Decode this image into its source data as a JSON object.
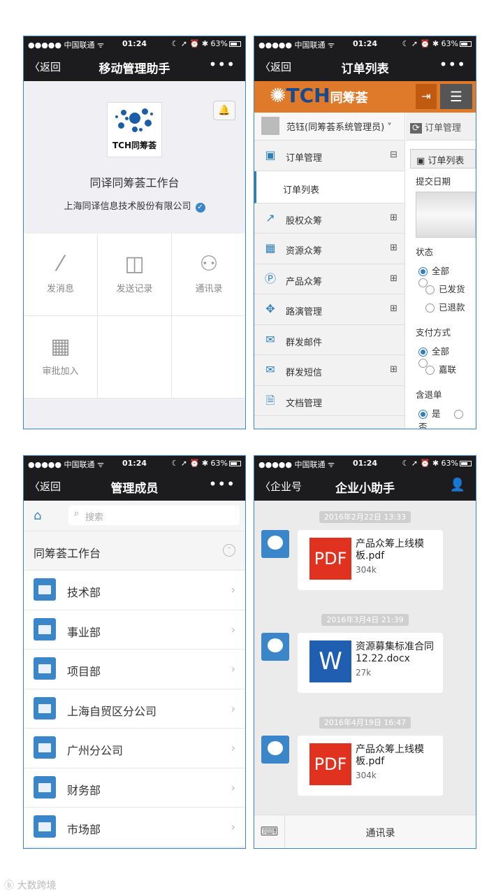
{
  "status": {
    "carrier": "●●●●● 中国联通 ᯤ",
    "time": "01:24",
    "battery": "63%",
    "icons": "☾ ➚ ⏰ ✱"
  },
  "p1": {
    "back": "返回",
    "title": "移动管理助手",
    "more": "•••",
    "logo_text": "TCH同筹荟",
    "org": "同译同筹荟工作台",
    "company": "上海同译信息技术股份有限公司",
    "grid": [
      "发消息",
      "发送记录",
      "通讯录",
      "审批加入"
    ]
  },
  "p2": {
    "back": "返回",
    "title": "订单列表",
    "more": "•••",
    "banner_text": "TCH",
    "banner_cn": "同筹荟",
    "user": "范钰(同筹荟系统管理员)",
    "menu": [
      {
        "label": "订单管理",
        "sign": "⊟"
      },
      {
        "label": "股权众筹",
        "sign": "⊞"
      },
      {
        "label": "资源众筹",
        "sign": "⊞"
      },
      {
        "label": "产品众筹",
        "sign": "⊞"
      },
      {
        "label": "路演管理",
        "sign": "⊞"
      },
      {
        "label": "群发邮件",
        "sign": ""
      },
      {
        "label": "群发短信",
        "sign": "⊞"
      },
      {
        "label": "文档管理",
        "sign": ""
      }
    ],
    "sub": "订单列表",
    "right_head": "订单管理",
    "right_title": "订单列表",
    "date_label": "提交日期",
    "state_label": "状态",
    "state_opts": [
      "全部",
      "已发货",
      "已退款"
    ],
    "pay_label": "支付方式",
    "pay_opts": [
      "全部",
      "嘉联"
    ],
    "refund_label": "含退单",
    "refund_opts": [
      "是",
      "否"
    ]
  },
  "p3": {
    "back": "返回",
    "title": "管理成员",
    "more": "•••",
    "search_placeholder": "搜索",
    "group": "同筹荟工作台",
    "depts": [
      "技术部",
      "事业部",
      "项目部",
      "上海自贸区分公司",
      "广州分公司",
      "财务部",
      "市场部"
    ]
  },
  "p4": {
    "back": "企业号",
    "title": "企业小助手",
    "messages": [
      {
        "time": "2016年2月22日 13:33",
        "type": "PDF",
        "name": "产品众筹上线模板.pdf",
        "size": "304k"
      },
      {
        "time": "2016年3月4日 21:39",
        "type": "W",
        "name": "资源募集标准合同12.22.docx",
        "size": "27k"
      },
      {
        "time": "2016年4月19日 16:47",
        "type": "PDF",
        "name": "产品众筹上线模板.pdf",
        "size": "304k"
      }
    ],
    "bottom": "通讯录"
  },
  "watermark": "ⓑ 大数跨境"
}
